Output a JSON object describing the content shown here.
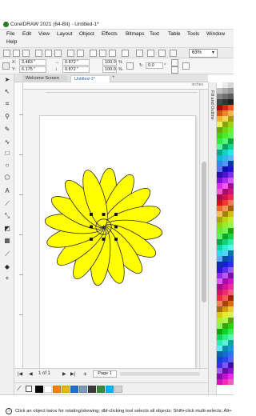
{
  "window": {
    "title": "CorelDRAW 2021 (64-Bit) - Untitled-1*"
  },
  "menu": [
    "File",
    "Edit",
    "View",
    "Layout",
    "Object",
    "Effects",
    "Bitmaps",
    "Text",
    "Table",
    "Tools",
    "Window",
    "Help"
  ],
  "toolbar": {
    "zoom_value": "63%"
  },
  "property_bar": {
    "x_label": "X:",
    "x_value": "3.483 \"",
    "y_label": "Y:",
    "y_value": "6.175 \"",
    "w_value": "0.872 \"",
    "h_value": "0.872 \"",
    "scale_w": "100.0",
    "scale_h": "100.0",
    "unit_pct": "%",
    "rotation_value": "0.0",
    "rotation_unit": "°"
  },
  "tabs": {
    "welcome": "Welcome Screen",
    "untitled": "Untitled-1*"
  },
  "ruler": {
    "unit_label": "inches"
  },
  "docker": {
    "label": "Fill and Outline"
  },
  "navigation": {
    "page_info": "1  of  1",
    "page_tab": "Page 1"
  },
  "status": {
    "message": "Click an object twice for rotating/skewing; dbl-clicking tool selects all objects; Shift+click multi-selects; Alt+"
  },
  "colors": {
    "petal_fill": "#ffff00",
    "petal_outline": "#222222",
    "accent_blue": "#245fb0"
  },
  "document_palette": [
    "#000000",
    "#ffffff",
    "#ff7f00",
    "#e8b800",
    "#1f6fd0",
    "#7a9ab8",
    "#3b3b3b",
    "#3a8a3a",
    "#00b7ff",
    "#d2d2d2"
  ],
  "flower": {
    "petal_count": 16
  }
}
